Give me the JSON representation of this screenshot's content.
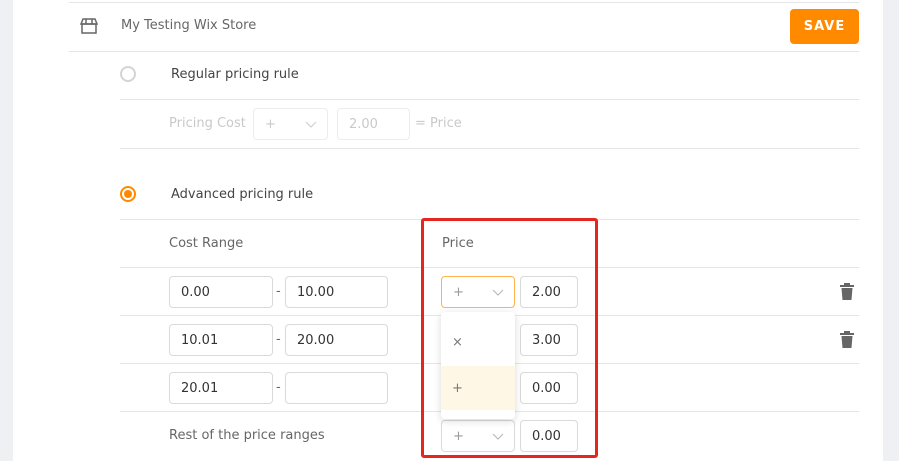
{
  "store": {
    "icon": "store-icon",
    "title": "My Testing Wix Store",
    "save_label": "SAVE"
  },
  "regular_rule": {
    "label": "Regular pricing rule",
    "checked": false,
    "cost_label": "Pricing Cost",
    "operator": "+",
    "value": "2.00",
    "equals_label": "= Price"
  },
  "advanced_rule": {
    "label": "Advanced pricing rule",
    "checked": true,
    "headers": {
      "cost_range": "Cost Range",
      "price": "Price"
    },
    "rows": [
      {
        "from": "0.00",
        "dash": "-",
        "to": "10.00",
        "operator": "+",
        "value": "2.00"
      },
      {
        "from": "10.01",
        "dash": "-",
        "to": "20.00",
        "operator": "",
        "value": "3.00"
      },
      {
        "from": "20.01",
        "dash": "-",
        "to": "",
        "operator": "",
        "value": "0.00"
      }
    ],
    "rest_label": "Rest of the price ranges",
    "rest_operator": "+",
    "rest_value": "0.00"
  },
  "operator_dropdown": {
    "options": [
      "×",
      "+"
    ],
    "selected": "+"
  },
  "colors": {
    "accent": "#ff8a00",
    "highlight_border": "#e5261f",
    "selected_option_bg": "#fff7e6"
  }
}
